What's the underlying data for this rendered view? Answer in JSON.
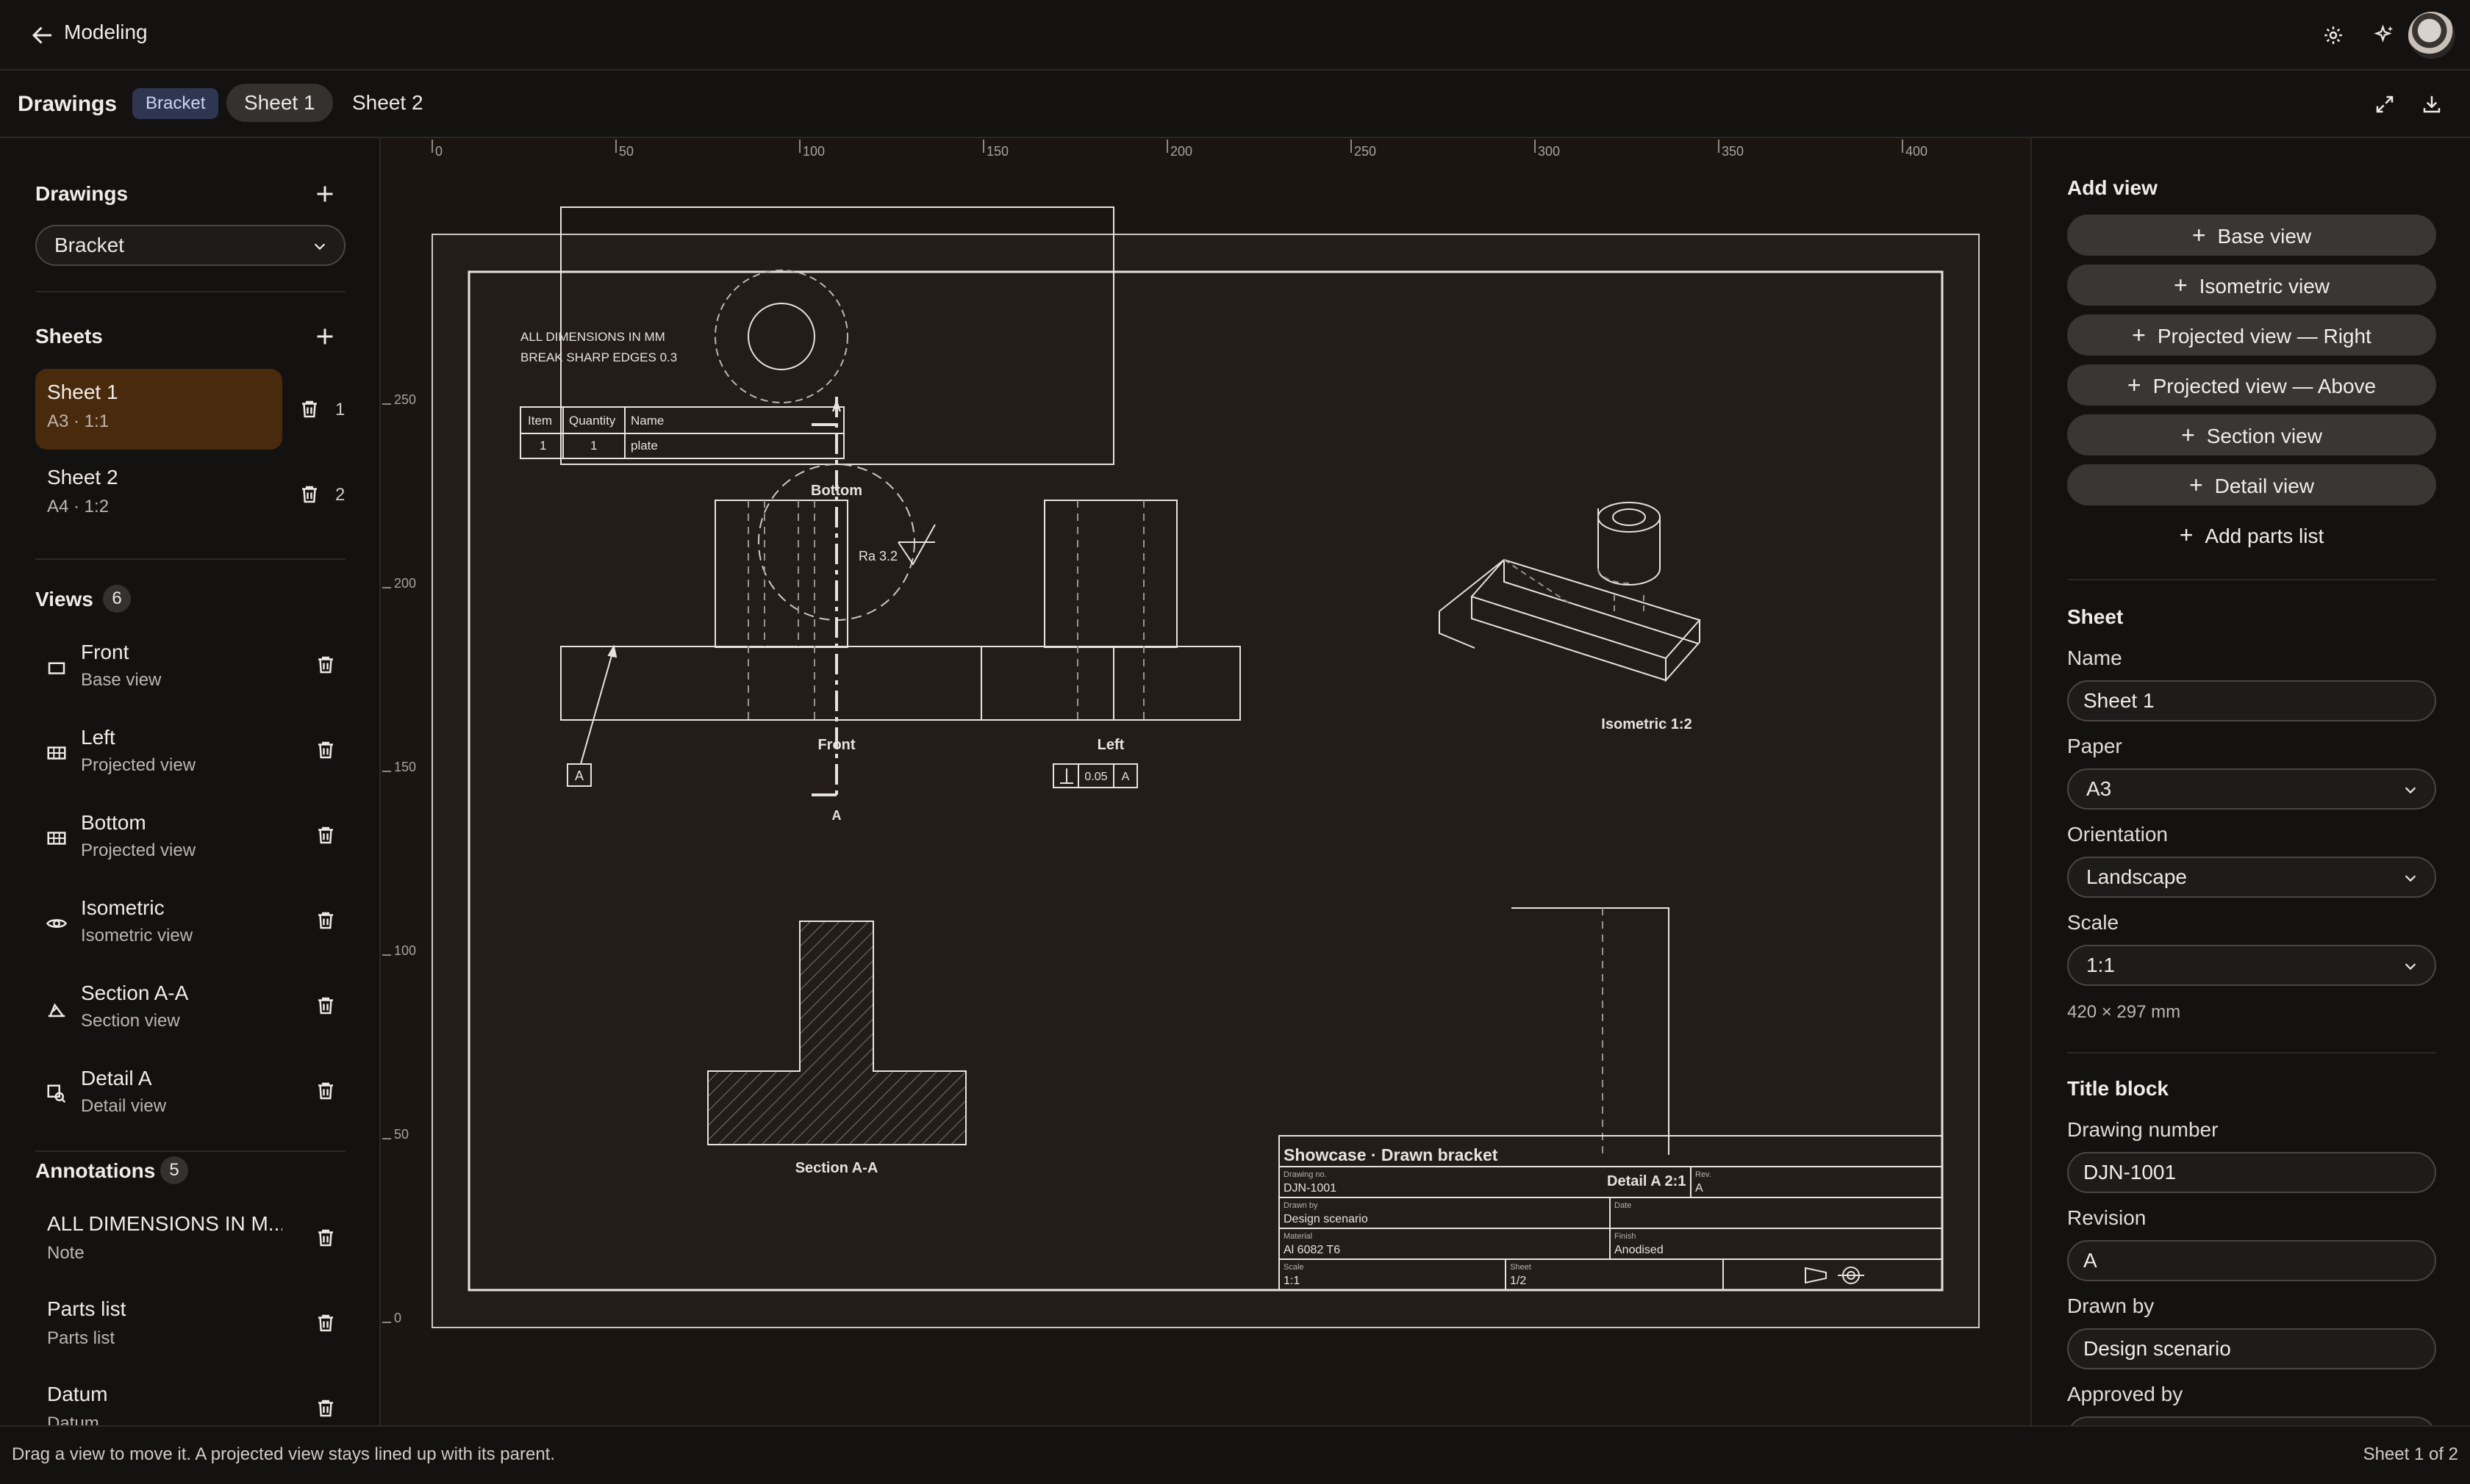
{
  "app": {
    "title": "Modeling"
  },
  "header": {
    "breadcrumb": "Drawings",
    "badge": "Bracket",
    "tabs": [
      {
        "label": "Sheet 1",
        "active": true
      },
      {
        "label": "Sheet 2",
        "active": false
      }
    ]
  },
  "sidebar": {
    "drawings": {
      "title": "Drawings",
      "selected": "Bracket"
    },
    "sheets": {
      "title": "Sheets",
      "items": [
        {
          "name": "Sheet 1",
          "sub": "A3 · 1:1",
          "count": "1"
        },
        {
          "name": "Sheet 2",
          "sub": "A4 · 1:2",
          "count": "2"
        }
      ]
    },
    "views": {
      "title": "Views",
      "count": "6",
      "items": [
        {
          "name": "Front",
          "sub": "Base view",
          "icon": "base-view-icon"
        },
        {
          "name": "Left",
          "sub": "Projected view",
          "icon": "projected-view-icon"
        },
        {
          "name": "Bottom",
          "sub": "Projected view",
          "icon": "projected-view-icon"
        },
        {
          "name": "Isometric",
          "sub": "Isometric view",
          "icon": "isometric-view-icon"
        },
        {
          "name": "Section A-A",
          "sub": "Section view",
          "icon": "section-view-icon"
        },
        {
          "name": "Detail A",
          "sub": "Detail view",
          "icon": "detail-view-icon"
        }
      ]
    },
    "annotations": {
      "title": "Annotations",
      "count": "5",
      "items": [
        {
          "name": "ALL DIMENSIONS IN M...",
          "sub": "Note"
        },
        {
          "name": "Parts list",
          "sub": "Parts list"
        },
        {
          "name": "Datum",
          "sub": "Datum"
        }
      ]
    }
  },
  "drawing": {
    "ruler_x": [
      "0",
      "50",
      "100",
      "150",
      "200",
      "250",
      "300",
      "350",
      "400"
    ],
    "ruler_y": [
      "250",
      "200",
      "150",
      "100",
      "50",
      "0"
    ],
    "note_lines": [
      "ALL DIMENSIONS IN MM",
      "BREAK SHARP EDGES 0.3"
    ],
    "parts_list": {
      "headers": [
        "Item",
        "Quantity",
        "Name"
      ],
      "rows": [
        [
          "1",
          "1",
          "plate"
        ]
      ]
    },
    "labels": {
      "bottom": "Bottom",
      "front": "Front",
      "left": "Left",
      "isometric": "Isometric 1:2",
      "section": "Section A-A",
      "section_mark": "A",
      "datum": "A",
      "roughness": "Ra 3.2",
      "tolerance_value": "0.05",
      "tolerance_datum": "A"
    },
    "title_block": {
      "title": "Showcase · Drawn bracket",
      "drawing_no_label": "Drawing no.",
      "drawing_no": "DJN-1001",
      "detail_label": "Detail A 2:1",
      "rev_label": "Rev.",
      "rev": "A",
      "drawn_by_label": "Drawn by",
      "drawn_by": "Design scenario",
      "date_label": "Date",
      "date": "",
      "material_label": "Material",
      "material": "Al 6082 T6",
      "finish_label": "Finish",
      "finish": "Anodised",
      "scale_label": "Scale",
      "scale": "1:1",
      "sheet_label": "Sheet",
      "sheet": "1/2"
    }
  },
  "right_panel": {
    "add_view": {
      "title": "Add view",
      "buttons": [
        "Base view",
        "Isometric view",
        "Projected view — Right",
        "Projected view — Above",
        "Section view",
        "Detail view"
      ],
      "link": "Add parts list"
    },
    "sheet": {
      "title": "Sheet",
      "name_label": "Name",
      "name_value": "Sheet 1",
      "paper_label": "Paper",
      "paper_value": "A3",
      "orientation_label": "Orientation",
      "orientation_value": "Landscape",
      "scale_label": "Scale",
      "scale_value": "1:1",
      "size_note": "420 × 297 mm"
    },
    "title_block": {
      "title": "Title block",
      "drawing_number_label": "Drawing number",
      "drawing_number_value": "DJN-1001",
      "revision_label": "Revision",
      "revision_value": "A",
      "drawn_by_label": "Drawn by",
      "drawn_by_value": "Design scenario",
      "approved_by_label": "Approved by"
    }
  },
  "status": {
    "hint": "Drag a view to move it. A projected view stays lined up with its parent.",
    "page": "Sheet 1 of 2"
  },
  "colors": {
    "background": "#131211",
    "canvas": "#1b1410",
    "accent_selected": "#4a2a0c",
    "badge": "#2e3652",
    "line": "#e8e2dc"
  }
}
